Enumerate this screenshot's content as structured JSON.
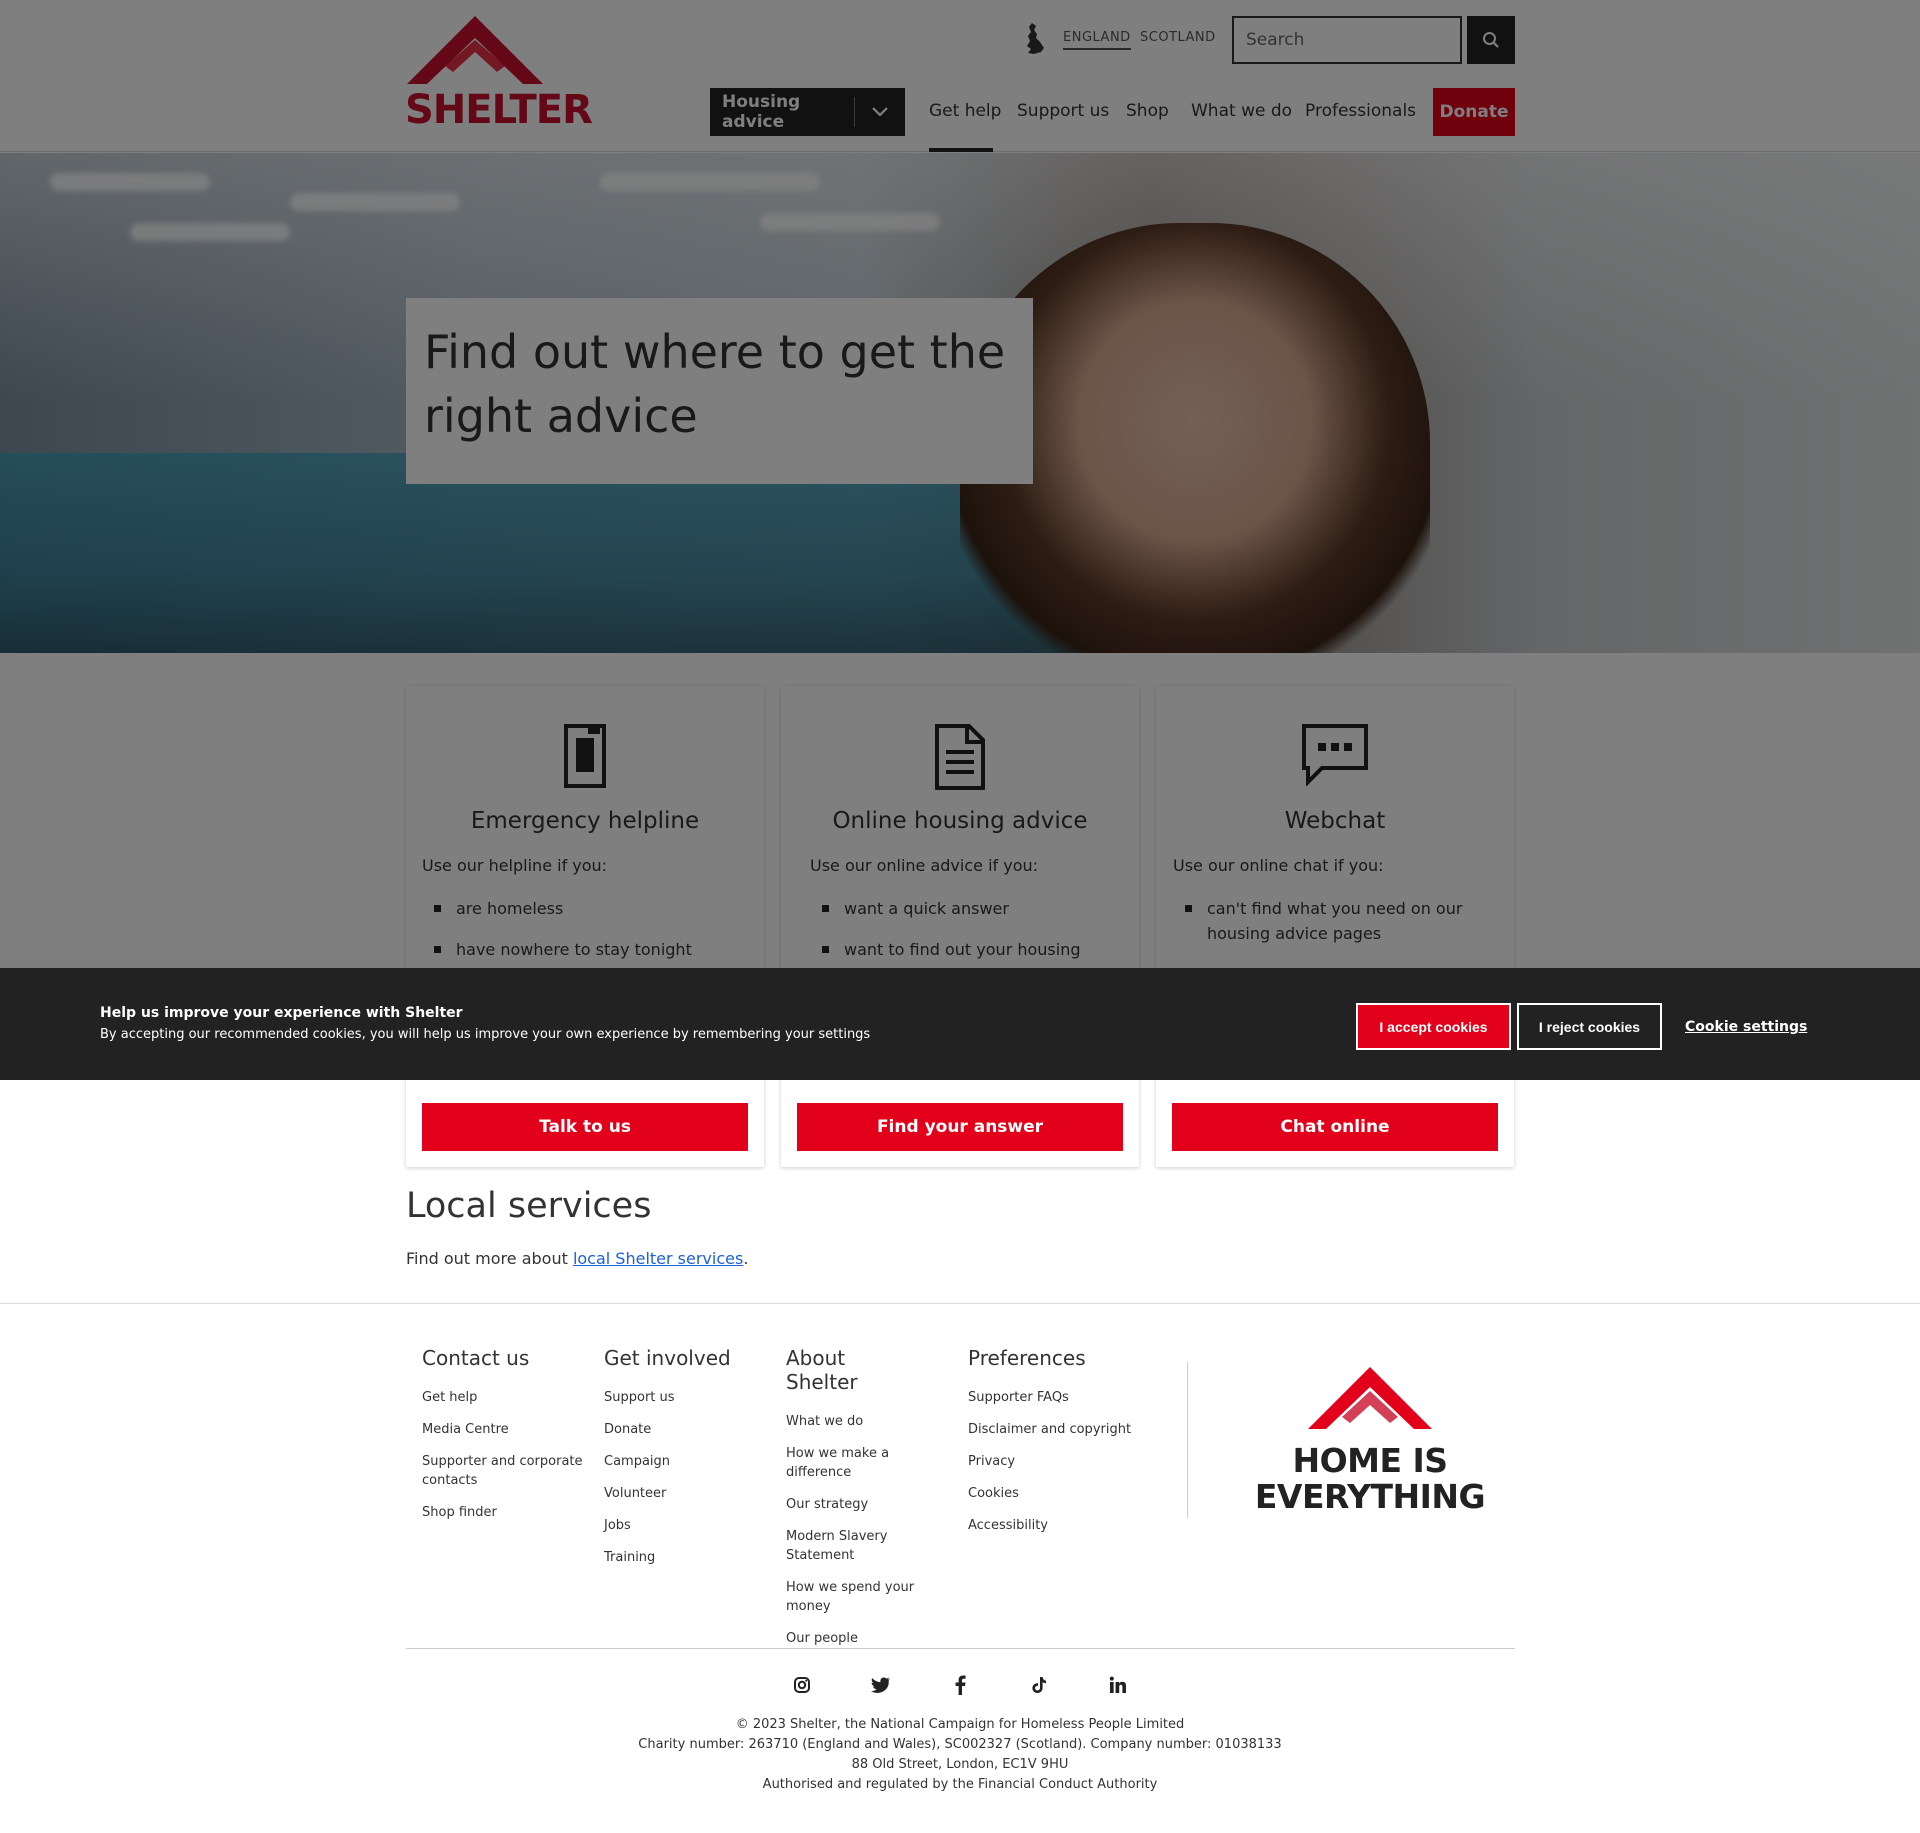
{
  "header": {
    "logo_text": "SHELTER",
    "regions": [
      "ENGLAND",
      "SCOTLAND"
    ],
    "search": {
      "placeholder": "Search"
    },
    "housing_advice": "Housing advice",
    "nav": [
      "Get help",
      "Support us",
      "Shop",
      "What we do",
      "Professionals"
    ],
    "donate": "Donate",
    "brand_color": "#e2001a"
  },
  "hero": {
    "title_line1": "Find out where to get the",
    "title_line2": "right advice"
  },
  "cards": [
    {
      "icon": "phone-icon",
      "title": "Emergency helpline",
      "intro": "Use our helpline if you:",
      "items": [
        "are homeless",
        "have nowhere to stay tonight"
      ],
      "button": "Talk to us"
    },
    {
      "icon": "document-icon",
      "title": "Online housing advice",
      "intro": "Use our online advice if you:",
      "items": [
        "want a quick answer",
        "want to find out your housing rights"
      ],
      "button": "Find your answer"
    },
    {
      "icon": "chat-icon",
      "title": "Webchat",
      "intro": "Use our online chat if you:",
      "items": [
        "can't find what you need on our housing advice pages"
      ],
      "button": "Chat online"
    }
  ],
  "cookie_bar": {
    "heading": "Help us improve your experience with Shelter",
    "text": "By accepting our recommended cookies, you will help us improve your own experience by remembering your settings",
    "accept": "I accept cookies",
    "reject": "I reject cookies",
    "settings": "Cookie settings"
  },
  "local_services": {
    "title": "Local services",
    "text_before": "Find out more about ",
    "link": "local Shelter services",
    "text_after": "."
  },
  "footer": {
    "columns": [
      {
        "title": "Contact us",
        "links": [
          "Get help",
          "Media Centre",
          "Supporter and corporate contacts",
          "Shop finder"
        ]
      },
      {
        "title": "Get involved",
        "links": [
          "Support us",
          "Donate",
          "Campaign",
          "Volunteer",
          "Jobs",
          "Training"
        ]
      },
      {
        "title": "About Shelter",
        "links": [
          "What we do",
          "How we make a difference",
          "Our strategy",
          "Modern Slavery Statement",
          "How we spend your money",
          "Our people"
        ]
      },
      {
        "title": "Preferences",
        "links": [
          "Supporter FAQs",
          "Disclaimer and copyright",
          "Privacy",
          "Cookies",
          "Accessibility"
        ]
      }
    ],
    "logo_line1": "HOME IS",
    "logo_line2": "EVERYTHING",
    "social": [
      "instagram-icon",
      "twitter-icon",
      "facebook-icon",
      "tiktok-icon",
      "linkedin-icon"
    ],
    "legal": [
      "© 2023 Shelter, the National Campaign for Homeless People Limited",
      "Charity number: 263710 (England and Wales), SC002327 (Scotland). Company number: 01038133",
      "88 Old Street, London, EC1V 9HU",
      "Authorised and regulated by the Financial Conduct Authority"
    ]
  }
}
